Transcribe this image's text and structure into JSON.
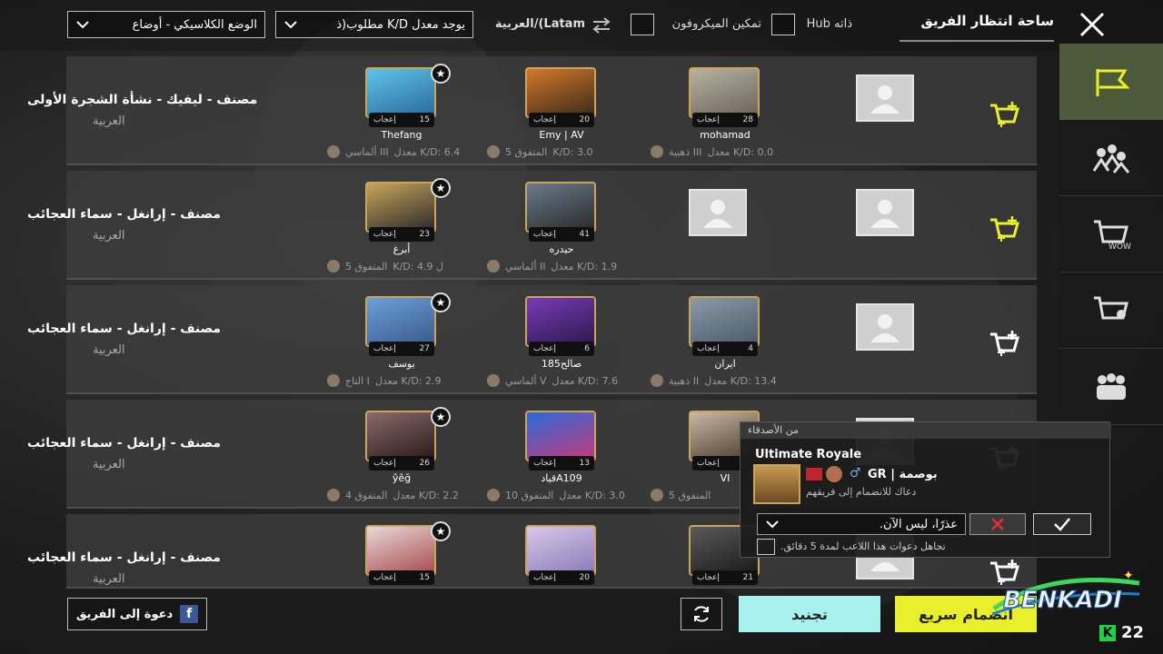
{
  "header": {
    "title": "ساحة انتظار الفريق",
    "hub_label": "Hub ذاته",
    "mic_label": "تمكين الميكروفون",
    "region_label": "العربية/(Latam",
    "kd_filter": "يوجد معدل K/D مطلوب(ذ",
    "mode_filter": "الوضع الكلاسيكي - أوضاع"
  },
  "teams": [
    {
      "name": "مصنف - ليفيك - نشأة الشجرة الأولى",
      "lang": "العربية",
      "slots": [
        {
          "name": "Thefang",
          "likes": "15",
          "likes_label": "إعجاب",
          "kd": "معدل K/D: 6.4",
          "tier": "ألماسي III",
          "empty": false
        },
        {
          "name": "Emy | AV",
          "likes": "20",
          "likes_label": "إعجاب",
          "kd": "K/D: 3.0",
          "tier": "المتفوق 5",
          "empty": false
        },
        {
          "name": "mohamad",
          "likes": "28",
          "likes_label": "إعجاب",
          "kd": "معدل K/D: 0.0",
          "tier": "ذهبية III",
          "empty": false
        },
        {
          "empty": true
        }
      ]
    },
    {
      "name": "مصنف - إرانغل - سماء العجائب",
      "lang": "العربية",
      "slots": [
        {
          "name": "أبرغ",
          "likes": "23",
          "likes_label": "إعجاب",
          "kd": "K/D: 4.9 ل",
          "tier": "المتفوق 5",
          "empty": false
        },
        {
          "name": "حيدره",
          "likes": "41",
          "likes_label": "إعجاب",
          "kd": "معدل K/D: 1.9",
          "tier": "ألماسي II",
          "empty": false
        },
        {
          "empty": true
        },
        {
          "empty": true
        }
      ]
    },
    {
      "name": "مصنف - إرانغل - سماء العجائب",
      "lang": "العربية",
      "slots": [
        {
          "name": "يوسف",
          "likes": "27",
          "likes_label": "إعجاب",
          "kd": "معدل K/D: 2.9",
          "tier": "التاج I",
          "empty": false
        },
        {
          "name": "صالح185",
          "likes": "6",
          "likes_label": "إعجاب",
          "kd": "معدل K/D: 7.6",
          "tier": "ألماسي V",
          "empty": false
        },
        {
          "name": "ايران",
          "likes": "4",
          "likes_label": "إعجاب",
          "kd": "معدل K/D: 13.4",
          "tier": "ذهبية II",
          "empty": false
        },
        {
          "empty": true
        }
      ]
    },
    {
      "name": "مصنف - إرانغل - سماء العجائب",
      "lang": "العربية",
      "slots": [
        {
          "name": "ŷêğ",
          "likes": "26",
          "likes_label": "إعجاب",
          "kd": "معدل K/D: 2.2",
          "tier": "المتفوق 4",
          "empty": false
        },
        {
          "name": "قيادA109",
          "likes": "13",
          "likes_label": "إعجاب",
          "kd": "معدل K/D: 3.0",
          "tier": "المتفوق 10",
          "empty": false
        },
        {
          "name": "VI",
          "likes": "",
          "likes_label": "إعجاب",
          "kd": "",
          "tier": "المتفوق 5",
          "empty": false
        },
        {
          "empty": true
        }
      ]
    },
    {
      "name": "مصنف - إرانغل - سماء العجائب",
      "lang": "العربية",
      "slots": [
        {
          "name": "",
          "likes": "15",
          "likes_label": "إعجاب",
          "kd": "",
          "tier": "",
          "empty": false
        },
        {
          "name": "",
          "likes": "20",
          "likes_label": "إعجاب",
          "kd": "",
          "tier": "",
          "empty": false
        },
        {
          "name": "",
          "likes": "21",
          "likes_label": "إعجاب",
          "kd": "",
          "tier": "",
          "empty": false
        },
        {
          "empty": true
        }
      ]
    }
  ],
  "invite_popup": {
    "header": "من الأصدقاء",
    "mode": "Ultimate Royale",
    "player": "بوصمة | GR",
    "message": "دعاك للانضمام إلى فريقهم",
    "decline_option": "عذرًا، ليس الآن.",
    "ignore_label": "تجاهل دعوات هذا اللاعب لمدة 5 دقائق."
  },
  "footer": {
    "invite_label": "دعوة إلى الفريق",
    "recruit_label": "تجنيد",
    "quick_join_label": "انضمام سريع"
  },
  "watermark": {
    "brand": "BENKADI",
    "count": "22"
  },
  "colors": {
    "accent_yellow": "#e9ef2a",
    "accent_cyan": "#a8f1ee",
    "side_active": "#4d5a3a",
    "gold": "#c9a45a"
  }
}
